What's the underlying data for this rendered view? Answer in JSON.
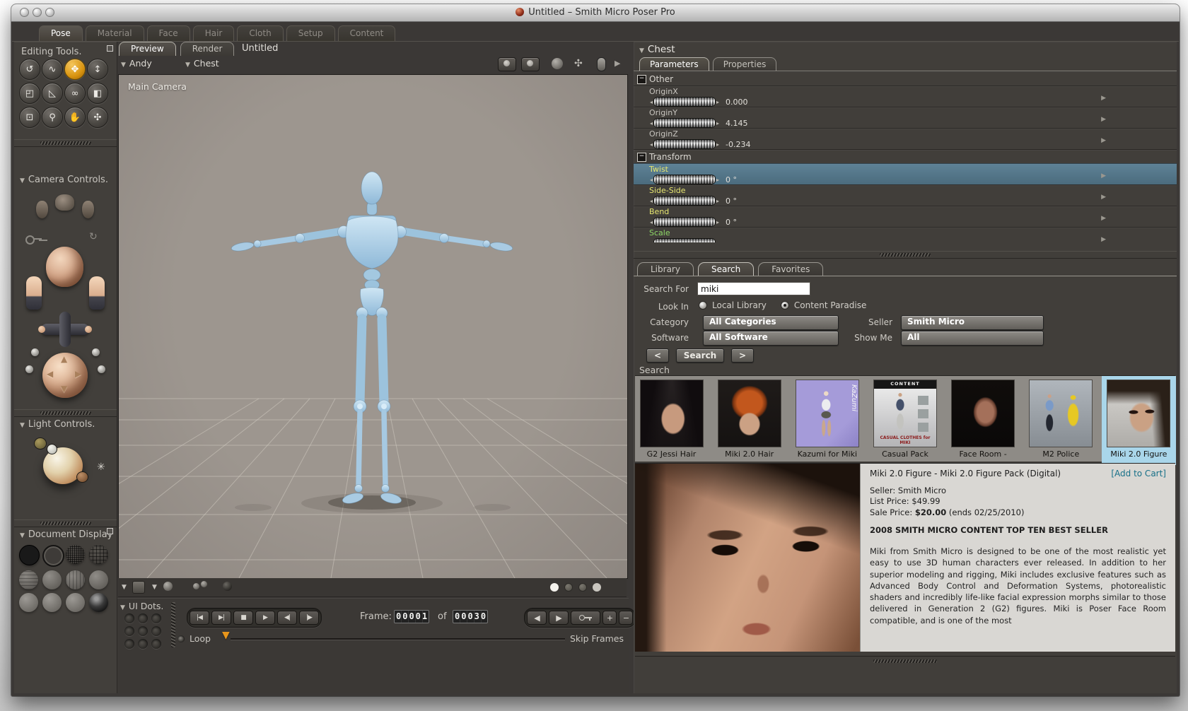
{
  "colors": {
    "accent_orange": "#e09a18",
    "highlight_row": "#53748a",
    "param_yellow": "#e6e670",
    "param_green": "#8cd666",
    "selected_thumb": "#a9d6ea",
    "link_teal": "#177088"
  },
  "window": {
    "title": "Untitled – Smith Micro Poser Pro"
  },
  "main_tabs": [
    {
      "label": "Pose",
      "active": true
    },
    {
      "label": "Material"
    },
    {
      "label": "Face"
    },
    {
      "label": "Hair"
    },
    {
      "label": "Cloth"
    },
    {
      "label": "Setup"
    },
    {
      "label": "Content"
    }
  ],
  "sidebar": {
    "editing_tools_title": "Editing Tools.",
    "tools": [
      {
        "name": "rotate",
        "glyph": "↺"
      },
      {
        "name": "twist",
        "glyph": "∿"
      },
      {
        "name": "translate-pull",
        "glyph": "✥",
        "active": true
      },
      {
        "name": "translate-in-out",
        "glyph": "↕"
      },
      {
        "name": "scale",
        "glyph": "◰"
      },
      {
        "name": "taper",
        "glyph": "◺"
      },
      {
        "name": "chain-break",
        "glyph": "∞"
      },
      {
        "name": "color",
        "glyph": "◧"
      },
      {
        "name": "morphing-tool",
        "glyph": "⊡"
      },
      {
        "name": "view-magnifier",
        "glyph": "⚲"
      },
      {
        "name": "grouping-tool",
        "glyph": "✋"
      },
      {
        "name": "direct-manipulation",
        "glyph": "✣"
      }
    ],
    "camera_controls_title": "Camera Controls.",
    "light_controls_title": "Light Controls.",
    "document_display_title": "Document Display",
    "display_styles": [
      "silhouette",
      "outline",
      "wireframe",
      "hidden-line",
      "lit-wireframe",
      "flat-shaded",
      "flat-lined",
      "cartoon",
      "smooth-shaded",
      "smooth-lined",
      "texture-shaded",
      "texture-lined"
    ]
  },
  "document": {
    "tabs": [
      {
        "label": "Preview",
        "active": true
      },
      {
        "label": "Render"
      }
    ],
    "title": "Untitled",
    "figure_menu": "Andy",
    "actor_menu": "Chest",
    "camera_label": "Main Camera"
  },
  "timeline": {
    "ui_dots_label": "UI Dots.",
    "frame_label": "Frame:",
    "frame_current": "00001",
    "of_label": "of",
    "frame_total": "00030",
    "loop_label": "Loop",
    "skip_frames_label": "Skip Frames",
    "transport": [
      {
        "name": "first-frame",
        "glyph": "|◀"
      },
      {
        "name": "last-frame",
        "glyph": "▶|"
      },
      {
        "name": "stop",
        "glyph": "■"
      },
      {
        "name": "play",
        "glyph": "▶"
      },
      {
        "name": "previous-frame",
        "glyph": "◀|"
      },
      {
        "name": "next-frame",
        "glyph": "|▶"
      }
    ],
    "key_controls": [
      {
        "name": "previous-keyframe",
        "glyph": "◀"
      },
      {
        "name": "next-keyframe",
        "glyph": "▶"
      },
      {
        "name": "edit-keyframes",
        "glyph": "key"
      },
      {
        "name": "add-keyframe",
        "glyph": "+"
      },
      {
        "name": "delete-keyframe",
        "glyph": "−"
      }
    ]
  },
  "parameters": {
    "actor_title": "Chest",
    "tabs": [
      {
        "label": "Parameters",
        "active": true
      },
      {
        "label": "Properties"
      }
    ],
    "groups": [
      {
        "name": "Other",
        "params": [
          {
            "label": "OriginX",
            "value": "0.000",
            "color": "gray"
          },
          {
            "label": "OriginY",
            "value": "4.145",
            "color": "gray"
          },
          {
            "label": "OriginZ",
            "value": "-0.234",
            "color": "gray"
          }
        ]
      },
      {
        "name": "Transform",
        "params": [
          {
            "label": "Twist",
            "value": "0 °",
            "color": "yellow",
            "highlight": true
          },
          {
            "label": "Side-Side",
            "value": "0 °",
            "color": "yellow"
          },
          {
            "label": "Bend",
            "value": "0 °",
            "color": "yellow"
          },
          {
            "label": "Scale",
            "value": "",
            "color": "green"
          }
        ]
      }
    ]
  },
  "library": {
    "tabs": [
      {
        "label": "Library"
      },
      {
        "label": "Search",
        "active": true
      },
      {
        "label": "Favorites"
      }
    ],
    "search_for_label": "Search For",
    "search_value": "miki",
    "look_in_label": "Look In",
    "radios": [
      {
        "label": "Local Library",
        "selected": false
      },
      {
        "label": "Content Paradise",
        "selected": true
      }
    ],
    "category_label": "Category",
    "category_value": "All Categories",
    "seller_label": "Seller",
    "seller_value": "Smith Micro",
    "software_label": "Software",
    "software_value": "All Software",
    "show_me_label": "Show Me",
    "show_me_value": "All",
    "prev_label": "<",
    "search_button_label": "Search",
    "next_label": ">",
    "results_header": "Search",
    "results": [
      {
        "caption": "G2 Jessi Hair",
        "style": "t-jessi"
      },
      {
        "caption": "Miki 2.0 Hair",
        "style": "t-mikihair"
      },
      {
        "caption": "Kazumi for Miki",
        "style": "t-kazumi",
        "side_text": "KaZumi"
      },
      {
        "caption": "Casual Pack",
        "style": "t-casual",
        "top_text": "CONTENT",
        "bottom_text": "CASUAL CLOTHES for MIKI"
      },
      {
        "caption": "Face Room -",
        "style": "t-faceroom"
      },
      {
        "caption": "M2 Police",
        "style": "t-police"
      },
      {
        "caption": "Miki 2.0 Figure",
        "style": "t-miki",
        "selected": true
      }
    ]
  },
  "product": {
    "title": "Miki 2.0 Figure - Miki 2.0 Figure Pack (Digital)",
    "add_to_cart": "[Add to Cart]",
    "seller_line": "Seller: Smith Micro",
    "list_price_line": "List Price: $49.99",
    "sale_price_prefix": "Sale Price: ",
    "sale_price": "$20.00",
    "sale_price_suffix": " (ends 02/25/2010)",
    "banner": "2008 SMITH MICRO CONTENT TOP TEN BEST SELLER",
    "description": "Miki from Smith Micro is designed to be one of the most realistic yet easy to use 3D human characters ever released. In addition to her superior modeling and rigging, Miki includes exclusive features such as Advanced Body Control and Deformation Systems, photorealistic shaders and incredibly life-like facial expression morphs similar to those delivered in Generation 2 (G2) figures. Miki is Poser Face Room compatible, and is one of the most"
  }
}
